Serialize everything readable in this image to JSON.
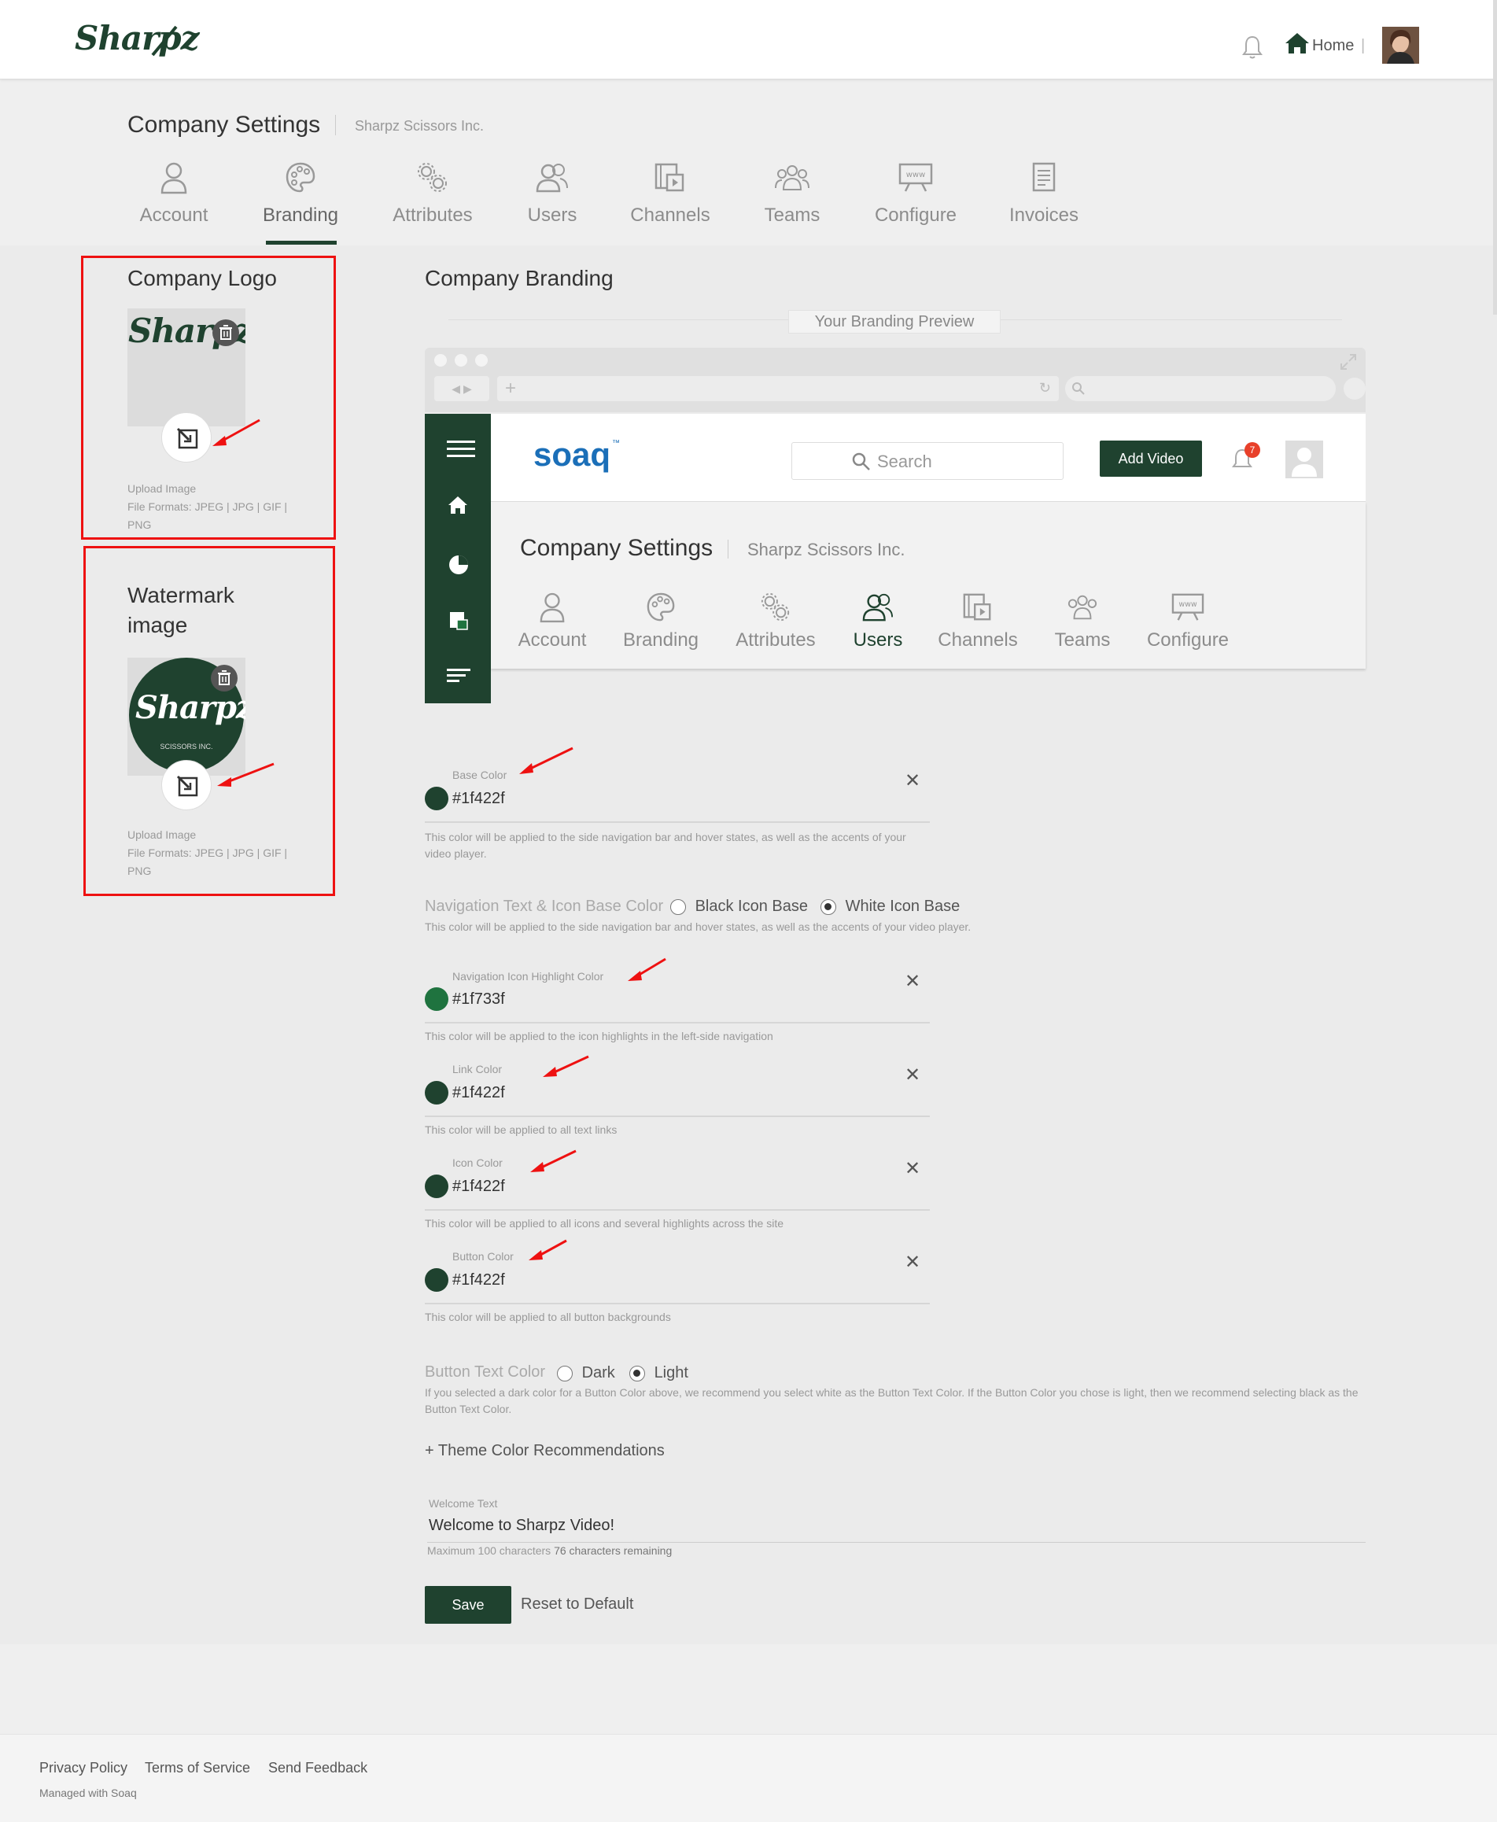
{
  "header": {
    "logo": "Sharpz",
    "home_label": "Home",
    "divider": "|"
  },
  "page": {
    "title": "Company Settings",
    "subtitle": "Sharpz Scissors Inc."
  },
  "tabs": [
    {
      "label": "Account",
      "icon": "person-icon"
    },
    {
      "label": "Branding",
      "icon": "palette-icon",
      "active": true
    },
    {
      "label": "Attributes",
      "icon": "gears-icon"
    },
    {
      "label": "Users",
      "icon": "users-icon"
    },
    {
      "label": "Channels",
      "icon": "channels-icon"
    },
    {
      "label": "Teams",
      "icon": "teams-icon"
    },
    {
      "label": "Configure",
      "icon": "configure-icon"
    },
    {
      "label": "Invoices",
      "icon": "invoice-icon"
    }
  ],
  "company_logo": {
    "title": "Company Logo",
    "logo_text": "Sharpz",
    "upload_label": "Upload Image",
    "formats": "File Formats: JPEG | JPG | GIF | PNG"
  },
  "watermark": {
    "title": "Watermark image",
    "logo_text": "Sharpz",
    "logo_sub": "SCISSORS INC.",
    "upload_label": "Upload Image",
    "formats": "File Formats: JPEG | JPG | GIF | PNG"
  },
  "branding": {
    "title": "Company Branding",
    "preview_label": "Your Branding Preview",
    "preview": {
      "logo": "soaq",
      "trademark": "™",
      "search_placeholder": "Search",
      "add_video": "Add Video",
      "notif_count": "7",
      "title": "Company Settings",
      "subtitle": "Sharpz Scissors Inc.",
      "tabs": [
        "Account",
        "Branding",
        "Attributes",
        "Users",
        "Channels",
        "Teams",
        "Configure"
      ],
      "active_tab": "Users"
    }
  },
  "colors": [
    {
      "label": "Base Color",
      "value": "#1f422f",
      "swatch": "#1f422f",
      "desc": "This color will be applied to the side navigation bar and hover states, as well as the accents of your video player."
    },
    {
      "label": "Navigation Icon Highlight Color",
      "value": "#1f733f",
      "swatch": "#1f733f",
      "desc": "This color will be applied to the icon highlights in the left-side navigation"
    },
    {
      "label": "Link Color",
      "value": "#1f422f",
      "swatch": "#1f422f",
      "desc": "This color will be applied to all text links"
    },
    {
      "label": "Icon Color",
      "value": "#1f422f",
      "swatch": "#1f422f",
      "desc": "This color will be applied to all icons and several highlights across the site"
    },
    {
      "label": "Button Color",
      "value": "#1f422f",
      "swatch": "#1f422f",
      "desc": "This color will be applied to all button backgrounds"
    }
  ],
  "nav_text": {
    "label": "Navigation Text & Icon Base Color",
    "option_black": "Black Icon Base",
    "option_white": "White Icon Base",
    "selected": "White Icon Base",
    "desc": "This color will be applied to the side navigation bar and hover states, as well as the accents of your video player."
  },
  "button_text": {
    "label": "Button Text Color",
    "option_dark": "Dark",
    "option_light": "Light",
    "selected": "Light",
    "desc": "If you selected a dark color for a Button Color above, we recommend you select white as the Button Text Color. If the Button Color you chose is light, then we recommend selecting black as the Button Text Color."
  },
  "theme_link": "+ Theme Color Recommendations",
  "welcome": {
    "label": "Welcome Text",
    "value": "Welcome to Sharpz Video!",
    "max": "Maximum 100 characters",
    "remaining": "76 characters remaining"
  },
  "actions": {
    "save": "Save",
    "reset": "Reset to Default"
  },
  "footer": {
    "privacy": "Privacy Policy",
    "terms": "Terms of Service",
    "feedback": "Send Feedback",
    "managed": "Managed with Soaq"
  },
  "theme": {
    "brand": "#1f422f",
    "highlight": "#1f733f",
    "annotation": "#e11111"
  }
}
